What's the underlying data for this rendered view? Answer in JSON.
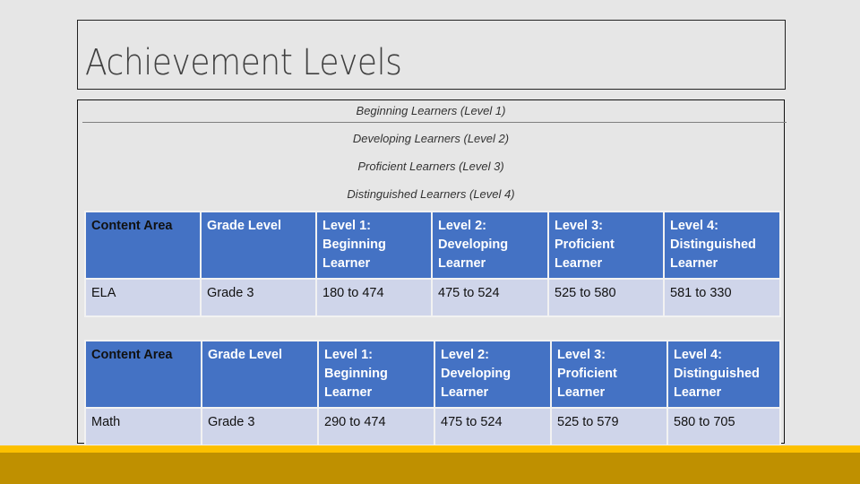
{
  "slide": {
    "title": "Achievement Levels",
    "legend": [
      "Beginning Learners (Level 1)",
      "Developing Learners (Level 2)",
      "Proficient Learners (Level 3)",
      "Distinguished Learners (Level 4)"
    ]
  },
  "tables": [
    {
      "headers": [
        "Content Area",
        "Grade Level",
        "Level 1: Beginning Learner",
        "Level 2: Developing Learner",
        "Level 3: Proficient Learner",
        "Level 4: Distinguished Learner"
      ],
      "row": [
        "ELA",
        "Grade 3",
        "180 to 474",
        "475 to 524",
        "525 to 580",
        "581 to 330"
      ]
    },
    {
      "headers": [
        "Content Area",
        "Grade Level",
        "Level 1: Beginning Learner",
        "Level 2: Developing Learner",
        "Level 3: Proficient Learner",
        "Level 4: Distinguished Learner"
      ],
      "row": [
        "Math",
        "Grade 3",
        "290 to 474",
        "475 to 524",
        "525 to 579",
        "580 to 705"
      ]
    }
  ],
  "colors": {
    "header_fill": "#4472c4",
    "row_fill": "#cfd5ea",
    "footer_light": "#fcc000",
    "footer_dark": "#bf9000",
    "background": "#e6e6e6"
  }
}
